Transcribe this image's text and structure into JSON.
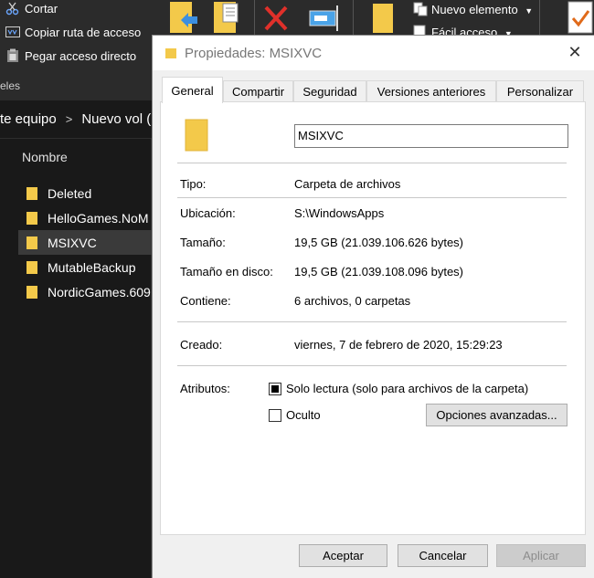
{
  "explorer": {
    "clipboard": {
      "cut_label": "Cortar",
      "copy_path_label": "Copiar ruta de acceso",
      "paste_shortcut_label": "Pegar acceso directo",
      "group_label": "eles"
    },
    "new_group": {
      "new_item_label": "Nuevo elemento",
      "easy_access_label": "Fácil acceso"
    },
    "address": {
      "crumb_1": "te equipo",
      "crumb_2": "Nuevo vol ("
    },
    "list": {
      "column_name": "Nombre",
      "items": [
        {
          "label": "Deleted"
        },
        {
          "label": "HelloGames.NoM"
        },
        {
          "label": "MSIXVC"
        },
        {
          "label": "MutableBackup"
        },
        {
          "label": "NordicGames.609"
        }
      ]
    }
  },
  "dialog": {
    "title": "Propiedades: MSIXVC",
    "tabs": [
      {
        "label": "General"
      },
      {
        "label": "Compartir"
      },
      {
        "label": "Seguridad"
      },
      {
        "label": "Versiones anteriores"
      },
      {
        "label": "Personalizar"
      }
    ],
    "name_value": "MSIXVC",
    "props": {
      "type_label": "Tipo:",
      "type_value": "Carpeta de archivos",
      "location_label": "Ubicación:",
      "location_value": "S:\\WindowsApps",
      "size_label": "Tamaño:",
      "size_value": "19,5 GB (21.039.106.626 bytes)",
      "size_disk_label": "Tamaño en disco:",
      "size_disk_value": "19,5 GB (21.039.108.096 bytes)",
      "contains_label": "Contiene:",
      "contains_value": "6 archivos, 0 carpetas",
      "created_label": "Creado:",
      "created_value": "viernes, 7 de febrero de 2020, 15:29:23",
      "attributes_label": "Atributos:"
    },
    "attributes": {
      "readonly_label": "Solo lectura (solo para archivos de la carpeta)",
      "readonly_state": "indeterminate",
      "hidden_label": "Oculto",
      "hidden_state": "unchecked",
      "advanced_label": "Opciones avanzadas..."
    },
    "buttons": {
      "ok_label": "Aceptar",
      "cancel_label": "Cancelar",
      "apply_label": "Aplicar"
    }
  },
  "colors": {
    "folder_yellow": "#f3c94a",
    "dark_bg": "#191919",
    "dialog_bg": "#f0f0f0"
  }
}
